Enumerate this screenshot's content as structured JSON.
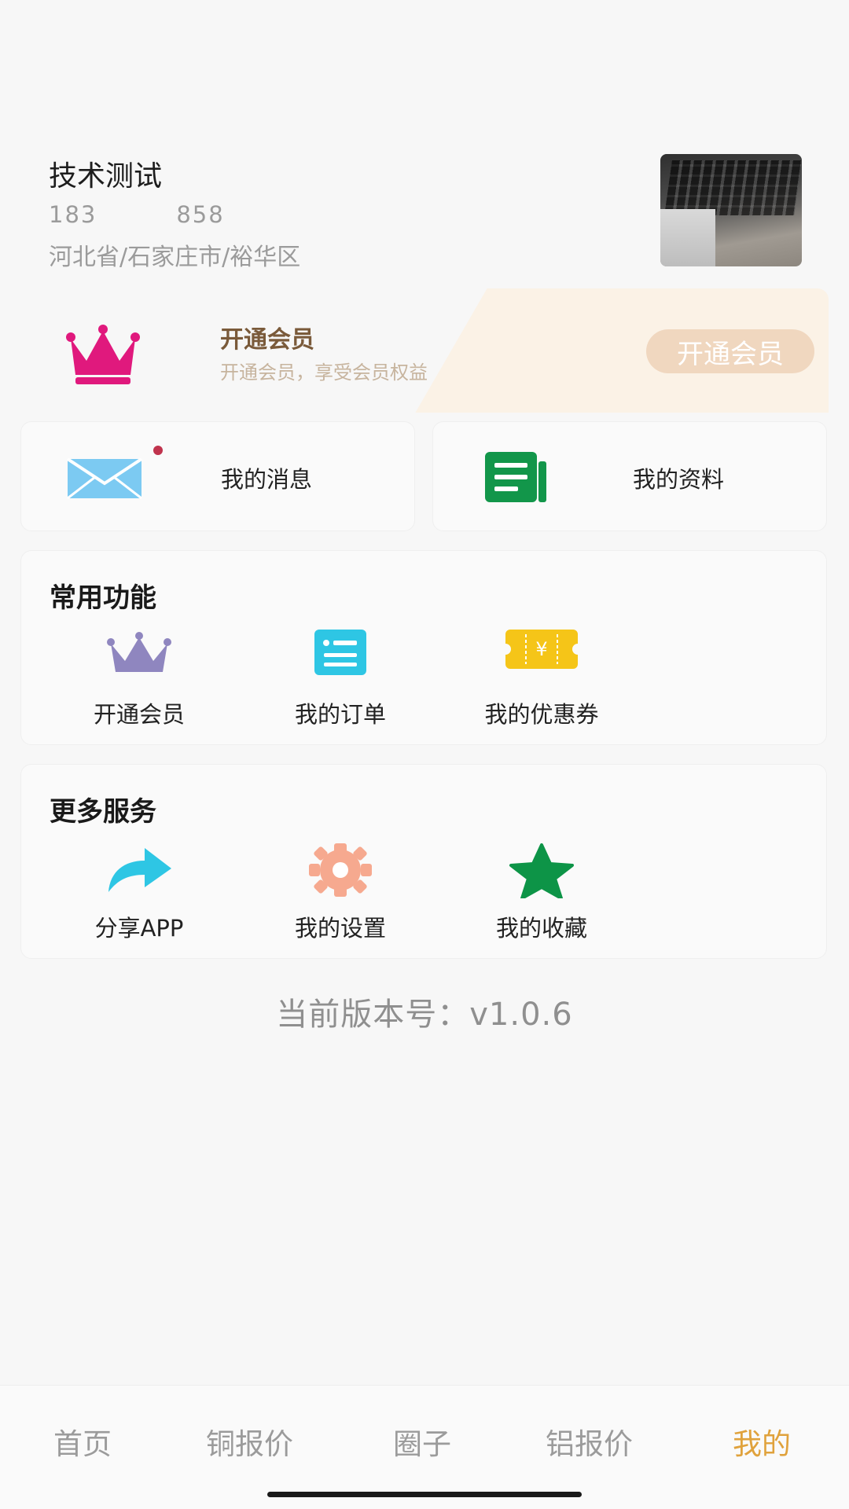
{
  "profile": {
    "name": "技术测试",
    "phone": "183         858",
    "location": "河北省/石家庄市/裕华区"
  },
  "vip_banner": {
    "title": "开通会员",
    "subtitle": "开通会员，享受会员权益",
    "button_label": "开通会员",
    "icon": "crown-icon",
    "accent": "#e0197d"
  },
  "quick_cards": [
    {
      "label": "我的消息",
      "icon": "envelope-icon",
      "has_unread_dot": true
    },
    {
      "label": "我的资料",
      "icon": "document-icon"
    }
  ],
  "common_functions": {
    "title": "常用功能",
    "items": [
      {
        "label": "开通会员",
        "icon": "crown-icon"
      },
      {
        "label": "我的订单",
        "icon": "order-icon"
      },
      {
        "label": "我的优惠券",
        "icon": "coupon-icon"
      }
    ]
  },
  "more_services": {
    "title": "更多服务",
    "items": [
      {
        "label": "分享APP",
        "icon": "share-icon"
      },
      {
        "label": "我的设置",
        "icon": "gear-icon"
      },
      {
        "label": "我的收藏",
        "icon": "star-icon"
      }
    ]
  },
  "version_text": "当前版本号：v1.0.6",
  "bottom_nav": {
    "items": [
      {
        "label": "首页"
      },
      {
        "label": "铜报价"
      },
      {
        "label": "圈子"
      },
      {
        "label": "铝报价"
      },
      {
        "label": "我的",
        "active": true
      }
    ],
    "active_color": "#e0a23c"
  }
}
